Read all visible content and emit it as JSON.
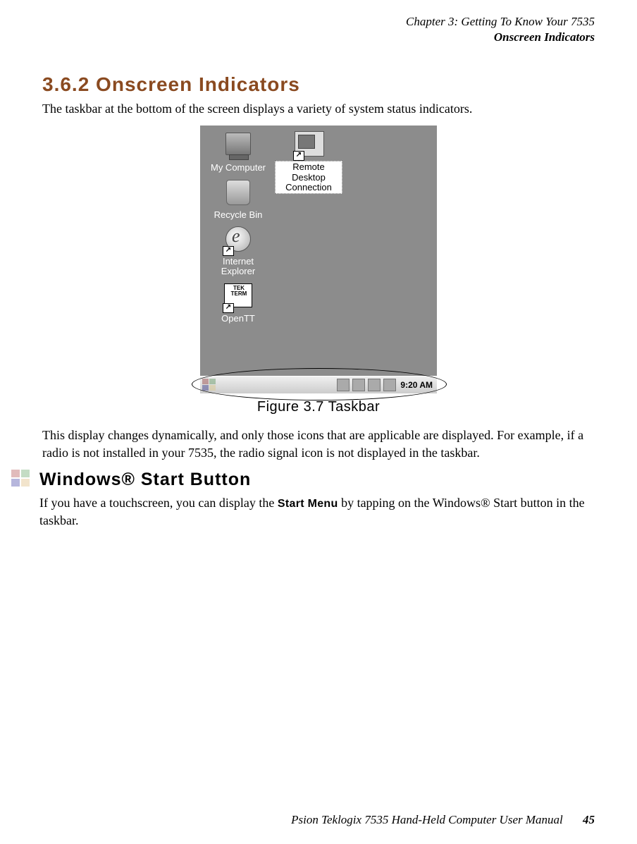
{
  "header": {
    "chapter": "Chapter  3:  Getting To Know Your 7535",
    "section": "Onscreen Indicators"
  },
  "section_heading": "3.6.2   Onscreen Indicators",
  "intro_paragraph": "The taskbar at the bottom of the screen displays a variety of system status indicators.",
  "screenshot": {
    "icons": {
      "my_computer": "My Computer",
      "recycle_bin": "Recycle Bin",
      "internet_explorer": "Internet Explorer",
      "open_tt": "OpenTT",
      "remote_desktop": "Remote Desktop Connection",
      "tekterm_text": "TEK TERM"
    },
    "taskbar": {
      "time": "9:20 AM"
    }
  },
  "figure_caption": "Figure 3.7 Taskbar",
  "paragraph2": "This display changes dynamically, and only those icons that are applicable are displayed. For example, if a radio is not installed in your 7535, the radio signal icon is not displayed in the taskbar.",
  "sub_heading": "Windows® Start Button",
  "paragraph3_pre": "If you have a touchscreen, you can display the ",
  "paragraph3_bold": "Start Menu",
  "paragraph3_post": " by tapping on the Windows® Start button in the taskbar.",
  "footer": {
    "title": "Psion Teklogix 7535 Hand-Held Computer User Manual",
    "page": "45"
  }
}
